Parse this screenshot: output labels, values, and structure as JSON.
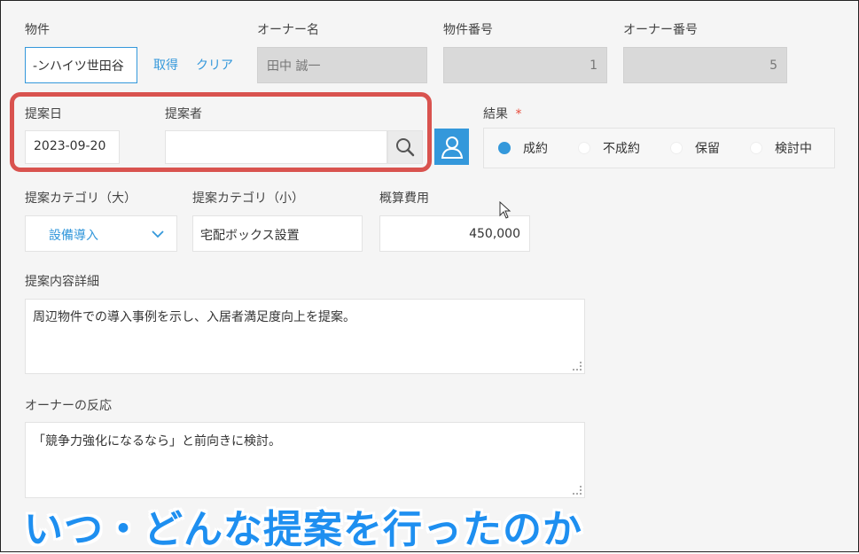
{
  "labels": {
    "property": "物件",
    "owner_name": "オーナー名",
    "property_number": "物件番号",
    "owner_number": "オーナー番号",
    "proposal_date": "提案日",
    "proposer": "提案者",
    "result": "結果",
    "required_mark": "*",
    "category_large": "提案カテゴリ（大）",
    "category_small": "提案カテゴリ（小）",
    "estimated_cost": "概算費用",
    "proposal_detail": "提案内容詳細",
    "owner_reaction": "オーナーの反応"
  },
  "fields": {
    "property_value": "-ンハイツ世田谷",
    "owner_name_value": "田中 誠一",
    "property_number_value": "1",
    "owner_number_value": "5",
    "proposal_date_value": "2023-09-20",
    "proposer_value": "",
    "category_large_value": "設備導入",
    "category_small_value": "宅配ボックス設置",
    "estimated_cost_value": "450,000",
    "proposal_detail_value": "周辺物件での導入事例を示し、入居者満足度向上を提案。",
    "owner_reaction_value": "「競争力強化になるなら」と前向きに検討。"
  },
  "buttons": {
    "fetch": "取得",
    "clear": "クリア"
  },
  "result_options": [
    "成約",
    "不成約",
    "保留",
    "検討中"
  ],
  "result_selected": "成約",
  "caption": "いつ・どんな提案を行ったのか",
  "colors": {
    "accent": "#3498db",
    "highlight_border": "#d9534f",
    "caption_text": "#1e8ff0"
  }
}
